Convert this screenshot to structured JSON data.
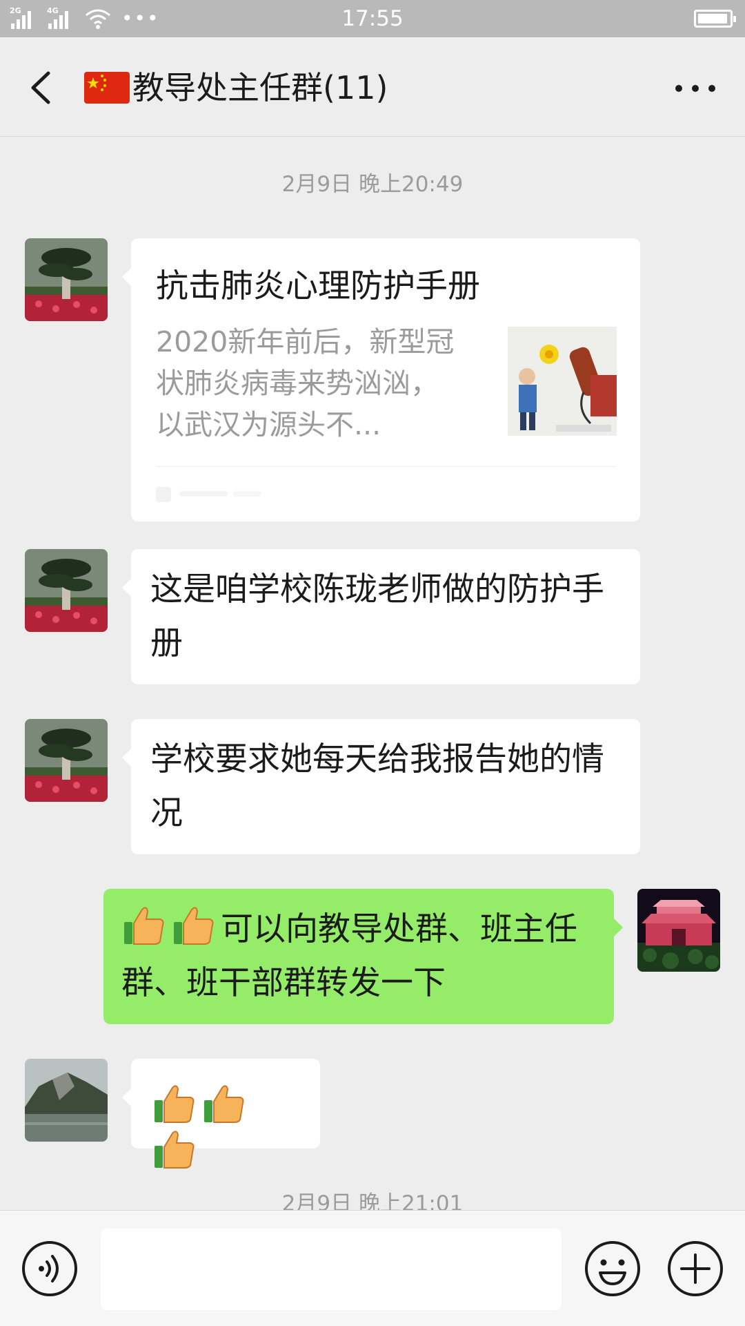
{
  "status_bar": {
    "time": "17:55",
    "signal_1_label": "2G",
    "signal_2_label": "4G",
    "more": "•••"
  },
  "header": {
    "title": "教导处主任群(11)"
  },
  "messages": {
    "timestamp_1": "2月9日 晚上20:49",
    "link_card": {
      "title": "抗击肺炎心理防护手册",
      "description": "2020新年前后，新型冠状肺炎病毒来势汹汹，以武汉为源头不..."
    },
    "msg_2": "这是咱学校陈珑老师做的防护手册",
    "msg_3": "学校要求她每天给我报告她的情况",
    "msg_4": "可以向教导处群、班主任群、班干部群转发一下",
    "timestamp_2": "2月9日 晚上21:01"
  },
  "input_bar": {
    "placeholder": ""
  },
  "colors": {
    "background": "#ededed",
    "bubble_self": "#95ec69",
    "bubble_other": "#ffffff",
    "timestamp": "#9b9b9b"
  }
}
